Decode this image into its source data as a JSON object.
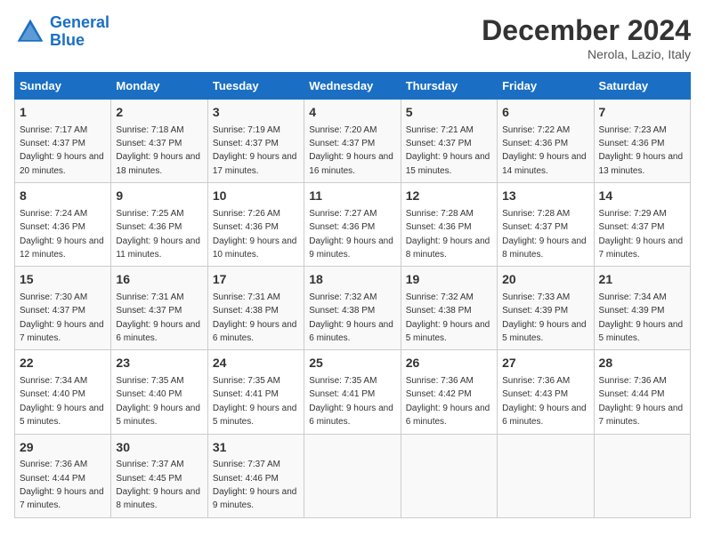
{
  "header": {
    "logo_line1": "General",
    "logo_line2": "Blue",
    "month": "December 2024",
    "location": "Nerola, Lazio, Italy"
  },
  "days_of_week": [
    "Sunday",
    "Monday",
    "Tuesday",
    "Wednesday",
    "Thursday",
    "Friday",
    "Saturday"
  ],
  "weeks": [
    [
      {
        "day": "1",
        "sunrise": "7:17 AM",
        "sunset": "4:37 PM",
        "daylight": "9 hours and 20 minutes."
      },
      {
        "day": "2",
        "sunrise": "7:18 AM",
        "sunset": "4:37 PM",
        "daylight": "9 hours and 18 minutes."
      },
      {
        "day": "3",
        "sunrise": "7:19 AM",
        "sunset": "4:37 PM",
        "daylight": "9 hours and 17 minutes."
      },
      {
        "day": "4",
        "sunrise": "7:20 AM",
        "sunset": "4:37 PM",
        "daylight": "9 hours and 16 minutes."
      },
      {
        "day": "5",
        "sunrise": "7:21 AM",
        "sunset": "4:37 PM",
        "daylight": "9 hours and 15 minutes."
      },
      {
        "day": "6",
        "sunrise": "7:22 AM",
        "sunset": "4:36 PM",
        "daylight": "9 hours and 14 minutes."
      },
      {
        "day": "7",
        "sunrise": "7:23 AM",
        "sunset": "4:36 PM",
        "daylight": "9 hours and 13 minutes."
      }
    ],
    [
      {
        "day": "8",
        "sunrise": "7:24 AM",
        "sunset": "4:36 PM",
        "daylight": "9 hours and 12 minutes."
      },
      {
        "day": "9",
        "sunrise": "7:25 AM",
        "sunset": "4:36 PM",
        "daylight": "9 hours and 11 minutes."
      },
      {
        "day": "10",
        "sunrise": "7:26 AM",
        "sunset": "4:36 PM",
        "daylight": "9 hours and 10 minutes."
      },
      {
        "day": "11",
        "sunrise": "7:27 AM",
        "sunset": "4:36 PM",
        "daylight": "9 hours and 9 minutes."
      },
      {
        "day": "12",
        "sunrise": "7:28 AM",
        "sunset": "4:36 PM",
        "daylight": "9 hours and 8 minutes."
      },
      {
        "day": "13",
        "sunrise": "7:28 AM",
        "sunset": "4:37 PM",
        "daylight": "9 hours and 8 minutes."
      },
      {
        "day": "14",
        "sunrise": "7:29 AM",
        "sunset": "4:37 PM",
        "daylight": "9 hours and 7 minutes."
      }
    ],
    [
      {
        "day": "15",
        "sunrise": "7:30 AM",
        "sunset": "4:37 PM",
        "daylight": "9 hours and 7 minutes."
      },
      {
        "day": "16",
        "sunrise": "7:31 AM",
        "sunset": "4:37 PM",
        "daylight": "9 hours and 6 minutes."
      },
      {
        "day": "17",
        "sunrise": "7:31 AM",
        "sunset": "4:38 PM",
        "daylight": "9 hours and 6 minutes."
      },
      {
        "day": "18",
        "sunrise": "7:32 AM",
        "sunset": "4:38 PM",
        "daylight": "9 hours and 6 minutes."
      },
      {
        "day": "19",
        "sunrise": "7:32 AM",
        "sunset": "4:38 PM",
        "daylight": "9 hours and 5 minutes."
      },
      {
        "day": "20",
        "sunrise": "7:33 AM",
        "sunset": "4:39 PM",
        "daylight": "9 hours and 5 minutes."
      },
      {
        "day": "21",
        "sunrise": "7:34 AM",
        "sunset": "4:39 PM",
        "daylight": "9 hours and 5 minutes."
      }
    ],
    [
      {
        "day": "22",
        "sunrise": "7:34 AM",
        "sunset": "4:40 PM",
        "daylight": "9 hours and 5 minutes."
      },
      {
        "day": "23",
        "sunrise": "7:35 AM",
        "sunset": "4:40 PM",
        "daylight": "9 hours and 5 minutes."
      },
      {
        "day": "24",
        "sunrise": "7:35 AM",
        "sunset": "4:41 PM",
        "daylight": "9 hours and 5 minutes."
      },
      {
        "day": "25",
        "sunrise": "7:35 AM",
        "sunset": "4:41 PM",
        "daylight": "9 hours and 6 minutes."
      },
      {
        "day": "26",
        "sunrise": "7:36 AM",
        "sunset": "4:42 PM",
        "daylight": "9 hours and 6 minutes."
      },
      {
        "day": "27",
        "sunrise": "7:36 AM",
        "sunset": "4:43 PM",
        "daylight": "9 hours and 6 minutes."
      },
      {
        "day": "28",
        "sunrise": "7:36 AM",
        "sunset": "4:44 PM",
        "daylight": "9 hours and 7 minutes."
      }
    ],
    [
      {
        "day": "29",
        "sunrise": "7:36 AM",
        "sunset": "4:44 PM",
        "daylight": "9 hours and 7 minutes."
      },
      {
        "day": "30",
        "sunrise": "7:37 AM",
        "sunset": "4:45 PM",
        "daylight": "9 hours and 8 minutes."
      },
      {
        "day": "31",
        "sunrise": "7:37 AM",
        "sunset": "4:46 PM",
        "daylight": "9 hours and 9 minutes."
      },
      null,
      null,
      null,
      null
    ]
  ]
}
